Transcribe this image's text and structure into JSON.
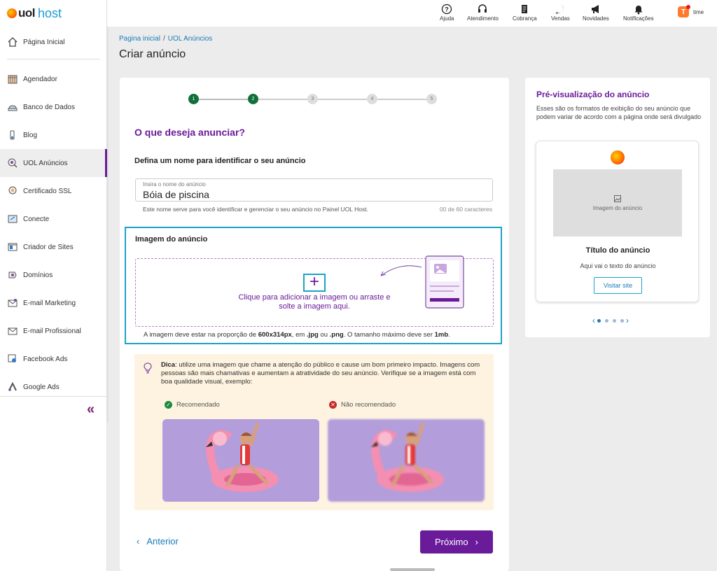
{
  "brand": {
    "uol": "uol",
    "host": "host"
  },
  "sidebar": {
    "items": [
      {
        "label": "Página Inicial",
        "icon": "home-icon"
      },
      {
        "label": "Agendador",
        "icon": "calendar-icon"
      },
      {
        "label": "Banco de Dados",
        "icon": "database-icon"
      },
      {
        "label": "Blog",
        "icon": "blog-icon"
      },
      {
        "label": "UOL Anúncios",
        "icon": "ads-icon"
      },
      {
        "label": "Certificado SSL",
        "icon": "certificate-icon"
      },
      {
        "label": "Conecte",
        "icon": "connect-icon"
      },
      {
        "label": "Criador de Sites",
        "icon": "site-builder-icon"
      },
      {
        "label": "Domínios",
        "icon": "domains-icon"
      },
      {
        "label": "E-mail Marketing",
        "icon": "email-marketing-icon"
      },
      {
        "label": "E-mail Profissional",
        "icon": "email-icon"
      },
      {
        "label": "Facebook Ads",
        "icon": "facebook-ads-icon"
      },
      {
        "label": "Google Ads",
        "icon": "google-ads-icon"
      }
    ],
    "collapse": "«"
  },
  "topbar": {
    "items": [
      {
        "label": "Ajuda",
        "icon": "help-icon"
      },
      {
        "label": "Atendimento",
        "icon": "headset-icon"
      },
      {
        "label": "Cobrança",
        "icon": "billing-icon"
      },
      {
        "label": "Vendas",
        "icon": "sales-icon"
      },
      {
        "label": "Novidades",
        "icon": "megaphone-icon"
      },
      {
        "label": "Notificações",
        "icon": "bell-icon"
      }
    ],
    "user": {
      "initial": "T",
      "name": "time"
    }
  },
  "breadcrumb": {
    "home": "Pagina inicial",
    "sep": "/",
    "current": "UOL Anúncios"
  },
  "page_title": "Criar anúncio",
  "stepper": {
    "steps": [
      "1",
      "2",
      "3",
      "4",
      "5"
    ],
    "completed": 2
  },
  "form": {
    "question": "O que deseja anunciar?",
    "name_label": "Defina um nome para identificar o seu anúncio",
    "name_placeholder": "Insira o nome do anúncio",
    "name_value": "Bóia de piscina",
    "name_help": "Este nome serve para você identificar e gerenciar o seu anúncio no Painel UOL Host.",
    "name_count": "00 de 60 caracteres",
    "image_label": "Imagem do anúncio",
    "drop_plus": "+",
    "drop_text": "Clique para adicionar a imagem ou arraste e solte a imagem aqui.",
    "hint_pre": "A imagem deve estar na proporção de ",
    "hint_size": "600x314px",
    "hint_mid1": ", em ",
    "hint_jpg": ".jpg",
    "hint_mid2": " ou ",
    "hint_png": ".png",
    "hint_mid3": ". O tamanho máximo deve ser ",
    "hint_max": "1mb",
    "hint_end": "."
  },
  "tip": {
    "label": "Dica",
    "text": ": utilize uma imagem que chame a atenção do público e cause um bom primeiro impacto. Imagens com pessoas são mais chamativas e aumentam a atratividade do seu anúncio. Verifique se a imagem está com boa qualidade visual, exemplo:",
    "recommended": "Recomendado",
    "not_recommended": "Não recomendado"
  },
  "nav_buttons": {
    "prev": "Anterior",
    "next": "Próximo"
  },
  "preview": {
    "title": "Pré-visualização do anúncio",
    "desc": "Esses são os formatos de exibição do seu anúncio que podem variar de acordo com a página onde será divulgado",
    "img_label": "Imagem do anúncio",
    "ad_title": "Título do anúncio",
    "ad_text": "Aqui vai o texto do anúncio",
    "button": "Visitar site",
    "slides": 4,
    "active_slide": 1
  },
  "colors": {
    "brand_purple": "#6a1b9a",
    "accent_cyan": "#1aa3c7",
    "link_blue": "#1a7bb9",
    "step_done": "#11703a",
    "tip_bg": "#fdf3e0"
  }
}
